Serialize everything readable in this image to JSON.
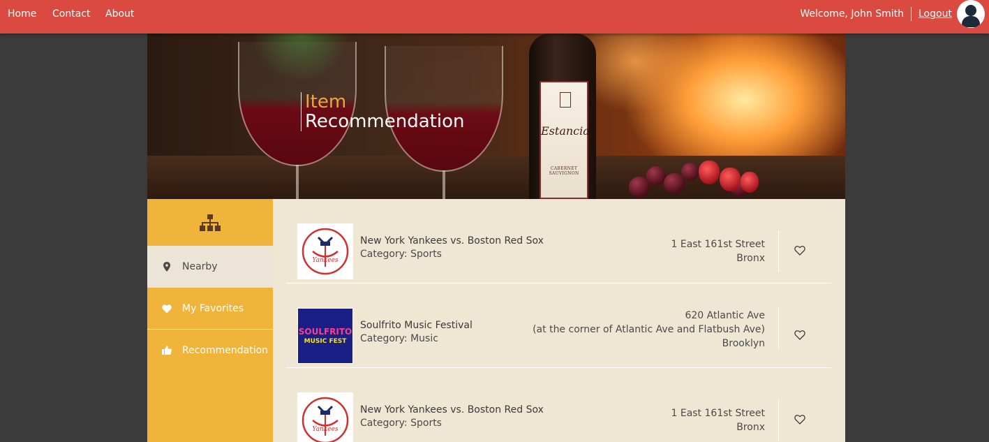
{
  "nav": {
    "home": "Home",
    "contact": "Contact",
    "about": "About",
    "welcome": "Welcome, John Smith",
    "logout": "Logout"
  },
  "hero": {
    "title_line1": "Item",
    "title_line2": "Recommendation",
    "bottle_label": "Estancia",
    "bottle_sub": "CABERNET SAUVIGNON"
  },
  "sidebar": {
    "items": [
      {
        "label": "Nearby",
        "icon": "map-pin-icon",
        "active": true
      },
      {
        "label": "My Favorites",
        "icon": "heart-icon",
        "active": false
      },
      {
        "label": "Recommendation",
        "icon": "thumbs-up-icon",
        "active": false
      }
    ]
  },
  "items": [
    {
      "name": "New York Yankees vs. Boston Red Sox",
      "category": "Category: Sports",
      "address": [
        "1 East 161st Street",
        "Bronx"
      ],
      "image": "yankees-logo"
    },
    {
      "name": "Soulfrito Music Festival",
      "category": "Category: Music",
      "address": [
        "620 Atlantic Ave",
        "(at the corner of Atlantic Ave and Flatbush Ave)",
        "Brooklyn"
      ],
      "image": "soulfrito-logo",
      "logo_text": [
        "SOULFRITO",
        "MUSIC FEST"
      ]
    },
    {
      "name": "New York Yankees vs. Boston Red Sox",
      "category": "Category: Sports",
      "address": [
        "1 East 161st Street",
        "Bronx"
      ],
      "image": "yankees-logo"
    }
  ],
  "colors": {
    "topbar": "#da4a41",
    "sidebar": "#f0b43a",
    "content_bg": "#f0e6d4",
    "title_accent": "#f0a43a"
  }
}
